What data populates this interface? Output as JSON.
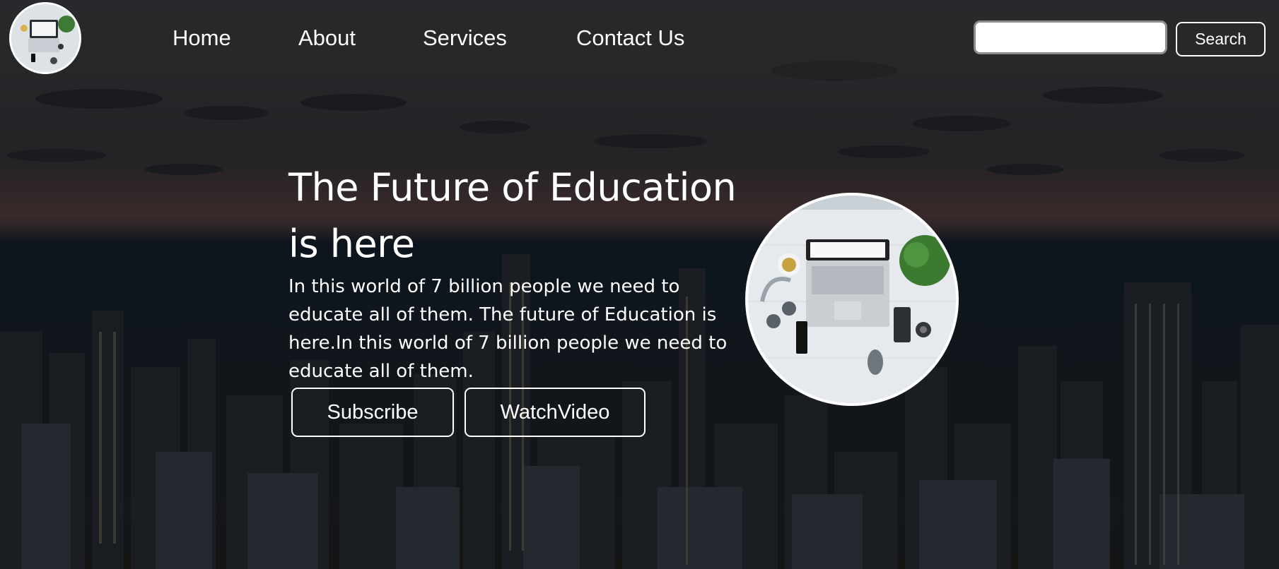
{
  "nav": {
    "links": [
      {
        "label": "Home"
      },
      {
        "label": "About"
      },
      {
        "label": "Services"
      },
      {
        "label": "Contact Us"
      }
    ],
    "search": {
      "value": "",
      "button_label": "Search"
    }
  },
  "hero": {
    "title": "The Future of Education is here",
    "paragraph": "In this world of 7 billion people we need to educate all of them. The future of Education is here.In this world of 7 billion people we need to educate all of them.",
    "buttons": {
      "subscribe": "Subscribe",
      "watch": "WatchVideo"
    }
  },
  "icons": {
    "logo": "laptop-desk-logo",
    "hero": "laptop-desk-photo"
  },
  "colors": {
    "text": "#ffffff",
    "navbar_bg": "#28282a",
    "button_border": "#ffffff"
  }
}
